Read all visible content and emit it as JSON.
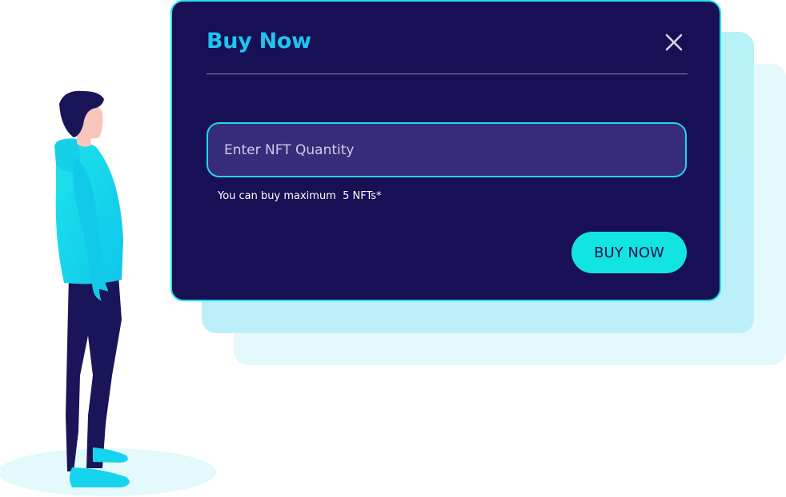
{
  "modal": {
    "title": "Buy Now",
    "close_icon": "close-icon",
    "quantity_placeholder": "Enter NFT Quantity",
    "quantity_value": "",
    "helper_text": "You can buy maximum  5 NFTs*",
    "buy_button_label": "BUY NOW"
  },
  "illustration": {
    "figure": "standing-person-illustration"
  },
  "colors": {
    "modal_bg": "#171054",
    "modal_border": "#1ee3e6",
    "title": "#1fc4ee",
    "input_bg": "#372c7a",
    "button_bg": "#11e4e1",
    "button_text": "#171054",
    "hoodie": "#17d4ee",
    "pants": "#1a1459"
  }
}
